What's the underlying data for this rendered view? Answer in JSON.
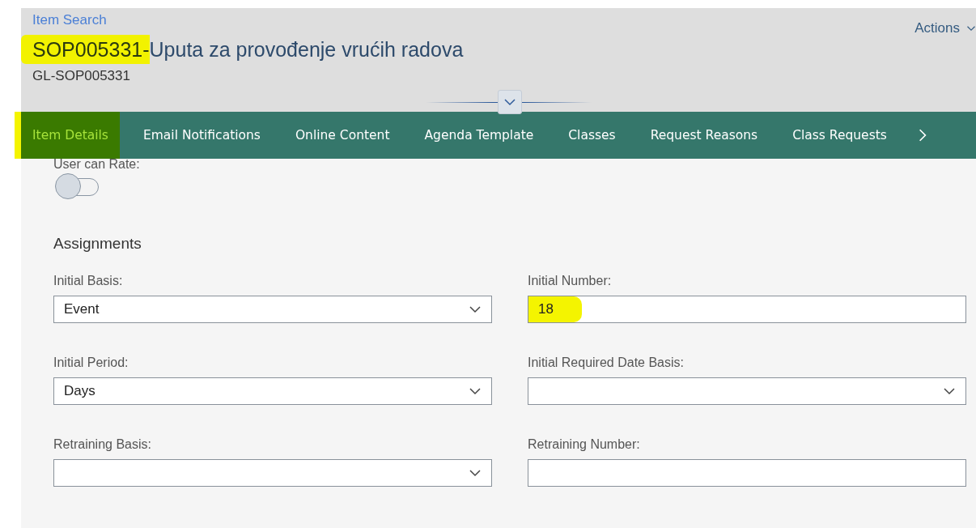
{
  "header": {
    "breadcrumb": "Item Search",
    "actions": "Actions",
    "title_code": "SOP005331-",
    "title_code_highlighted": true,
    "title_name": "Uputa za provođenje vrućih radova",
    "subtitle": "GL-SOP005331",
    "collapsed": false
  },
  "tabs": [
    {
      "label": "Item Details",
      "selected": true,
      "highlighted": true
    },
    {
      "label": "Email Notifications",
      "selected": false,
      "highlighted": false
    },
    {
      "label": "Online Content",
      "selected": false,
      "highlighted": false
    },
    {
      "label": "Agenda Template",
      "selected": false,
      "highlighted": false
    },
    {
      "label": "Classes",
      "selected": false,
      "highlighted": false
    },
    {
      "label": "Request Reasons",
      "selected": false,
      "highlighted": false
    },
    {
      "label": "Class Requests",
      "selected": false,
      "highlighted": false
    }
  ],
  "rating": {
    "label": "User can Rate:",
    "on": false
  },
  "section": {
    "title": "Assignments"
  },
  "fields": [
    {
      "label": "Initial Basis:",
      "kind": "select",
      "value": "Event",
      "highlighted": false
    },
    {
      "label": "Initial Number:",
      "kind": "text",
      "value": "18",
      "highlighted": true
    },
    {
      "label": "Initial Period:",
      "kind": "select",
      "value": "Days",
      "highlighted": false
    },
    {
      "label": "Initial Required Date Basis:",
      "kind": "select",
      "highlighted": false
    },
    {
      "label": "Retraining Basis:",
      "kind": "select",
      "highlighted": false
    },
    {
      "label": "Retraining Number:",
      "kind": "text",
      "highlighted": false
    }
  ]
}
